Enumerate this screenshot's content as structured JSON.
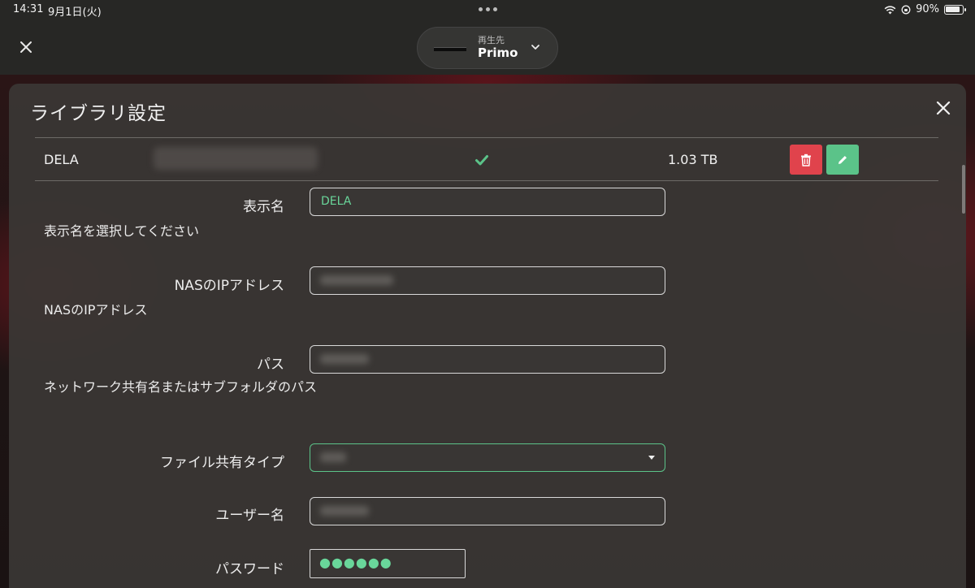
{
  "status_bar": {
    "time": "14:31",
    "date": "9月1日(火)",
    "battery": "90%"
  },
  "app_bar": {
    "player_label": "再生先",
    "player_name": "Primo"
  },
  "panel": {
    "title": "ライブラリ設定",
    "library_row": {
      "name": "DELA",
      "size": "1.03 TB"
    },
    "form": {
      "display_name": {
        "label": "表示名",
        "value": "DELA",
        "help": "表示名を選択してください"
      },
      "nas_ip": {
        "label": "NASのIPアドレス",
        "help": "NASのIPアドレス"
      },
      "path": {
        "label": "パス",
        "help": "ネットワーク共有名またはサブフォルダのパス"
      },
      "share_type": {
        "label": "ファイル共有タイプ"
      },
      "username": {
        "label": "ユーザー名"
      },
      "password": {
        "label": "パスワード",
        "value": "●●●●●●"
      }
    }
  },
  "colors": {
    "accent_green": "#5bc389",
    "delete_red": "#e0434c",
    "panel_bg": "#3a3735"
  },
  "icons": {
    "close": "close-icon",
    "chevron": "chevron-down-icon",
    "check": "check-icon",
    "trash": "trash-icon",
    "pencil": "pencil-icon",
    "wifi": "wifi-icon",
    "battery": "battery-icon"
  }
}
